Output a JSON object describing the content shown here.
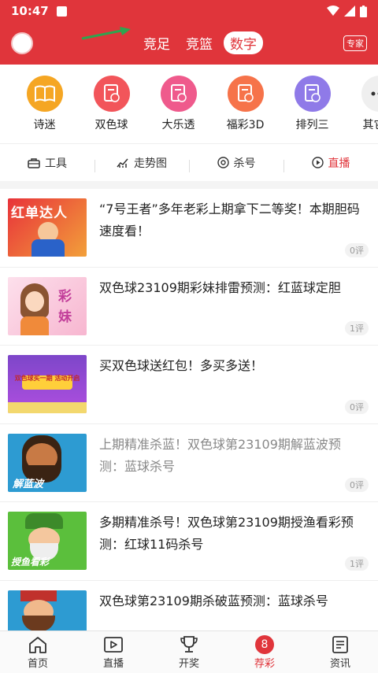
{
  "status_bar": {
    "time": "10:47"
  },
  "header": {
    "tabs": [
      {
        "label": "竞足"
      },
      {
        "label": "竞篮"
      },
      {
        "label": "数字",
        "active": true
      }
    ],
    "expert_label": "专家"
  },
  "categories": [
    {
      "label": "诗迷",
      "color": "#f5a623"
    },
    {
      "label": "双色球",
      "color": "#f2555a"
    },
    {
      "label": "大乐透",
      "color": "#ef5a8c"
    },
    {
      "label": "福彩3D",
      "color": "#f6734a"
    },
    {
      "label": "排列三",
      "color": "#8f7ae8"
    },
    {
      "label": "其它彩",
      "color": "#f0f0f0"
    }
  ],
  "tools": [
    {
      "label": "工具"
    },
    {
      "label": "走势图"
    },
    {
      "label": "杀号"
    },
    {
      "label": "直播"
    }
  ],
  "news": [
    {
      "title": "“7号王者”多年老彩上期拿下二等奖！本期胆码速度看！",
      "comments": "0评",
      "thumb_text": "红单达人",
      "read": false
    },
    {
      "title": "双色球23109期彩妹排雷预测：红蓝球定胆",
      "comments": "1评",
      "thumb_text": "彩妹",
      "read": false
    },
    {
      "title": "买双色球送红包！多买多送！",
      "comments": "0评",
      "thumb_text": "双色球买一期 活动开启",
      "read": false
    },
    {
      "title": "上期精准杀蓝！双色球第23109期解蓝波预测：蓝球杀号",
      "comments": "0评",
      "thumb_text": "解蓝波",
      "read": true
    },
    {
      "title": "多期精准杀号！双色球第23109期授渔看彩预测：红球11码杀号",
      "comments": "1评",
      "thumb_text": "授鱼看彩",
      "read": false
    },
    {
      "title": "双色球第23109期杀破蓝预测：蓝球杀号",
      "comments": "",
      "thumb_text": "",
      "read": false
    }
  ],
  "bottom_nav": [
    {
      "label": "首页"
    },
    {
      "label": "直播"
    },
    {
      "label": "开奖"
    },
    {
      "label": "荐彩",
      "badge": "8",
      "active": true
    },
    {
      "label": "资讯"
    }
  ],
  "colors": {
    "brand_red": "#e0353b"
  }
}
